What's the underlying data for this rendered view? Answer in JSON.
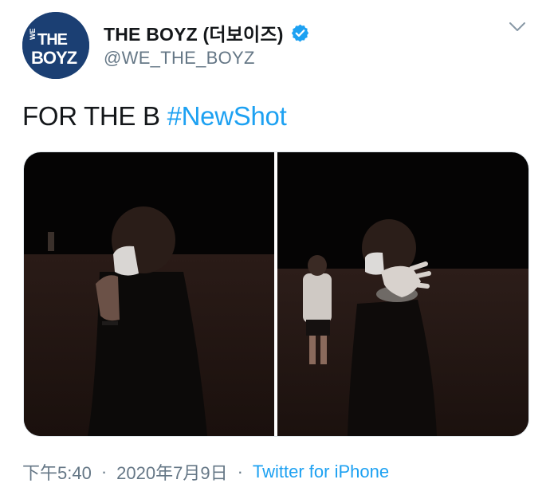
{
  "account": {
    "avatar_text_line1": "WE THE",
    "avatar_text_line2": "BOYZ",
    "display_name": "THE BOYZ (더보이즈)",
    "handle": "@WE_THE_BOYZ",
    "verified": true
  },
  "tweet": {
    "text": "FOR THE B",
    "hashtag": "#NewShot",
    "media_count": 2
  },
  "meta": {
    "time": "下午5:40",
    "separator": "·",
    "date": "2020年7月9日",
    "source": "Twitter for iPhone"
  },
  "colors": {
    "accent": "#1da1f2",
    "secondary_text": "#657786",
    "avatar_bg": "#1b3f73"
  },
  "icons": {
    "verified": "verified-badge-icon",
    "menu": "chevron-down-icon"
  }
}
